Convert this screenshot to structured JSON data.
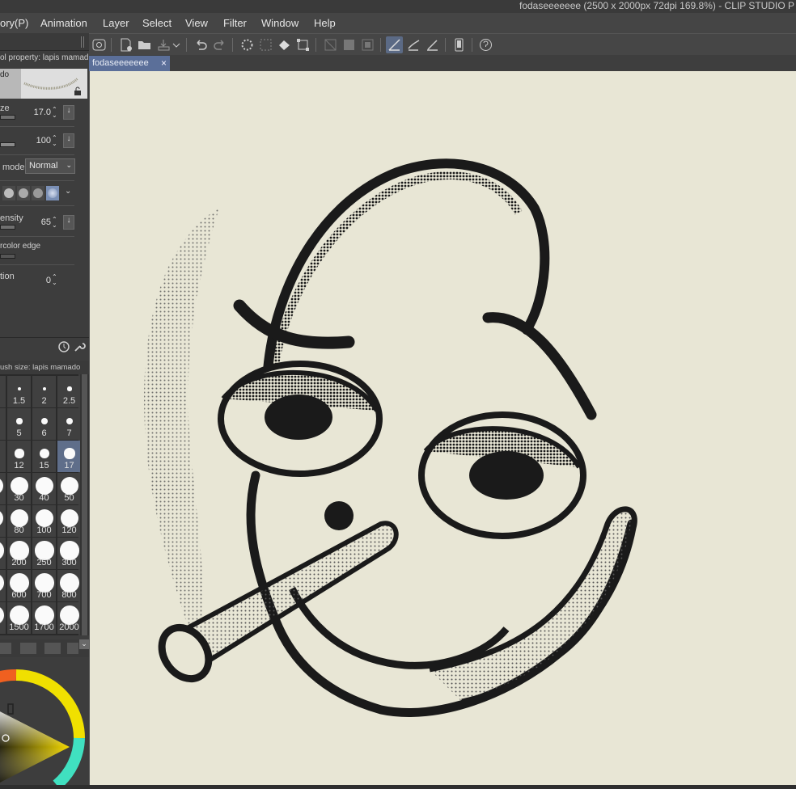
{
  "window": {
    "title": "fodaseeeeeee (2500 x 2000px 72dpi 169.8%)  - CLIP STUDIO P"
  },
  "menu": [
    "ory(P)",
    "Animation",
    "Layer",
    "Select",
    "View",
    "Filter",
    "Window",
    "Help"
  ],
  "toolbar": {
    "icons": [
      "clip-studio-icon",
      "new-file-icon",
      "open-folder-icon",
      "save-icon",
      "dropdown-icon",
      "undo-icon",
      "redo-icon",
      "loading-icon",
      "selection-launcher-icon",
      "fill-icon",
      "transform-icon",
      "clear-outside-icon",
      "clear-icon",
      "fill-selection-icon",
      "draw-line-icon",
      "brush-snap-icon",
      "ruler-snap-icon",
      "device-icon",
      "help-icon"
    ]
  },
  "document_tab": {
    "label": "fodaseeeeeee",
    "close": "×"
  },
  "tool_property": {
    "title": "ol property: lapis mamad",
    "preview_tag": "do",
    "size": {
      "label": "ze",
      "value": "17.0",
      "level": 0.17
    },
    "opacity": {
      "value": "100",
      "level": 1.0
    },
    "blend": {
      "label": "mode",
      "value": "Normal"
    },
    "density": {
      "label": "ensity",
      "value": "65",
      "level": 0.65
    },
    "watercolor_edge": {
      "label": "rcolor edge"
    },
    "stabilization": {
      "label": "tion",
      "value": "0"
    }
  },
  "brush_size": {
    "title": "ush size: lapis mamado",
    "sizes": [
      "",
      "1.5",
      "2",
      "2.5",
      "",
      "5",
      "6",
      "7",
      "",
      "12",
      "15",
      "17",
      "",
      "30",
      "40",
      "50",
      "",
      "80",
      "100",
      "120",
      "",
      "200",
      "250",
      "300",
      "",
      "600",
      "700",
      "800",
      "",
      "1500",
      "1700",
      "2000"
    ],
    "selected": "17"
  },
  "colors": {
    "canvas": "#e8e6d5",
    "ink": "#1a1a1a",
    "accent": "#5b6f99"
  }
}
